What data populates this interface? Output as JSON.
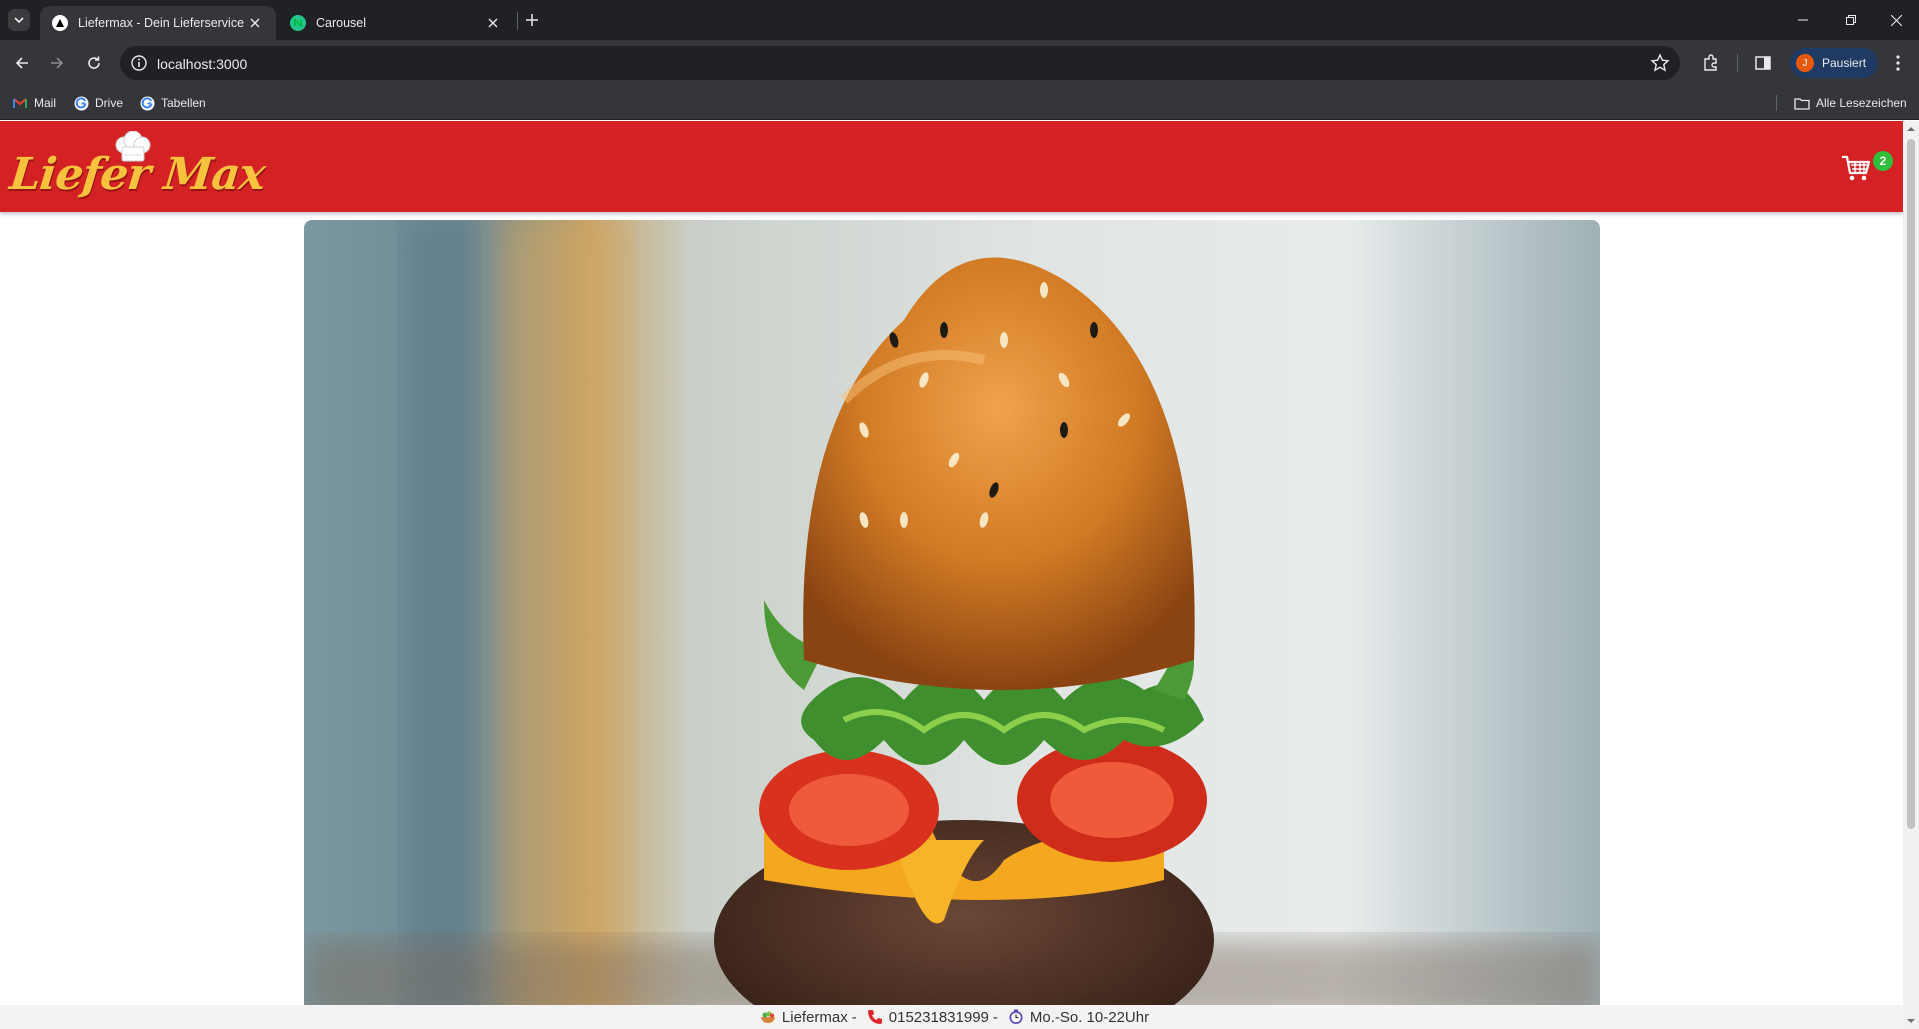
{
  "browser": {
    "tabs": [
      {
        "title": "Liefermax - Dein Lieferservice",
        "active": true
      },
      {
        "title": "Carousel",
        "active": false
      }
    ],
    "url": "localhost:3000",
    "profile_initial": "J",
    "profile_label": "Pausiert",
    "bookmarks": [
      "Mail",
      "Drive",
      "Tabellen"
    ],
    "all_bookmarks": "Alle Lesezeichen"
  },
  "header": {
    "logo_text": "Liefer Max",
    "cart_count": "2"
  },
  "footer": {
    "brand": "Liefermax",
    "phone": "015231831999",
    "hours": "Mo.-So. 10-22Uhr",
    "separator": "-"
  },
  "colors": {
    "header_red": "#d42124",
    "logo_yellow": "#f7c23e",
    "badge_green": "#2fbf3a"
  }
}
